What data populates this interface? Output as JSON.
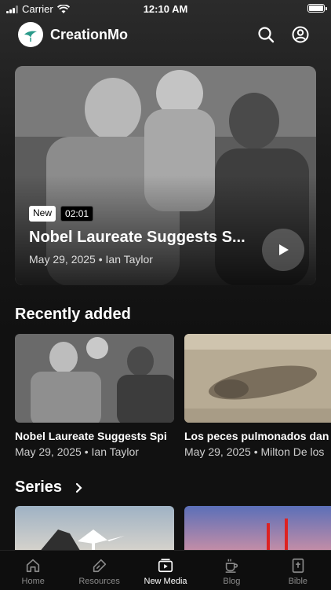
{
  "status_bar": {
    "carrier": "Carrier",
    "time": "12:10 AM"
  },
  "header": {
    "app_title": "CreationMo"
  },
  "hero": {
    "badge_new": "New",
    "duration": "02:01",
    "title": "Nobel Laureate Suggests S...",
    "meta": "May 29, 2025 • Ian Taylor"
  },
  "recently_added": {
    "heading": "Recently added",
    "items": [
      {
        "title": "Nobel Laureate Suggests Spi",
        "meta": "May 29, 2025 • Ian Taylor"
      },
      {
        "title": "Los peces pulmonados dan",
        "meta": "May 29, 2025 • Milton De los"
      }
    ]
  },
  "series": {
    "heading": "Series"
  },
  "tabbar": {
    "tabs": [
      {
        "label": "Home",
        "icon": "home-icon"
      },
      {
        "label": "Resources",
        "icon": "pen-icon"
      },
      {
        "label": "New Media",
        "icon": "media-icon"
      },
      {
        "label": "Blog",
        "icon": "coffee-icon"
      },
      {
        "label": "Bible",
        "icon": "bible-icon"
      }
    ],
    "active": "New Media"
  },
  "colors": {
    "background": "#111111",
    "text": "#ffffff",
    "muted": "#8a8a8a"
  }
}
